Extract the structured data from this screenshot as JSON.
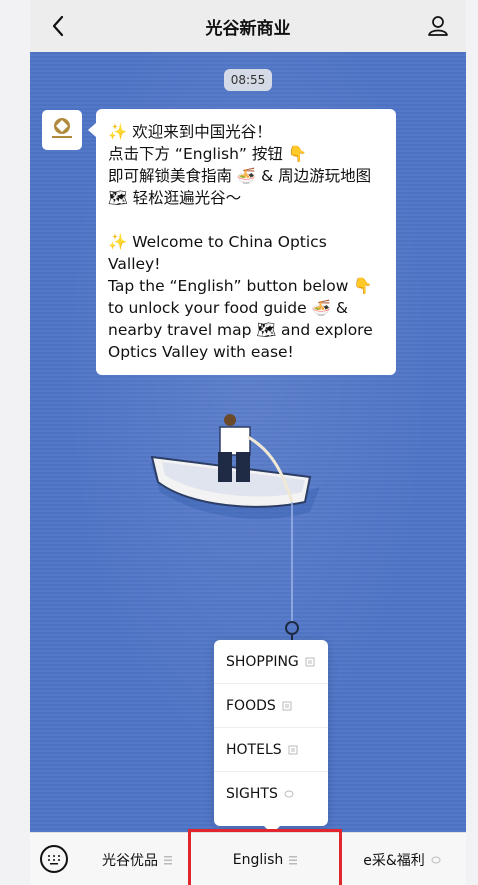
{
  "header": {
    "title": "光谷新商业"
  },
  "chat": {
    "time": "08:55",
    "avatar_alt": "光谷新商业",
    "message_cn": "✨ 欢迎来到中国光谷！\n点击下方 “English” 按钮 👇\n即可解锁美食指南 🍜 & 周边游玩地图\n🗺 轻松逛遍光谷～",
    "message_en": "✨ Welcome to China Optics Valley!\nTap the “English” button below 👇\nto unlock your food guide 🍜 &\nnearby travel map 🗺 and explore\nOptics Valley with ease!"
  },
  "popup": {
    "items": [
      {
        "label": "SHOPPING"
      },
      {
        "label": "FOODS"
      },
      {
        "label": "HOTELS"
      },
      {
        "label": "SIGHTS"
      }
    ]
  },
  "bottom": {
    "tabs": [
      {
        "label": "光谷优品"
      },
      {
        "label": "English"
      },
      {
        "label": "e采&福利"
      }
    ]
  },
  "colors": {
    "highlight": "#e1262d",
    "background": "#4f74c6"
  }
}
